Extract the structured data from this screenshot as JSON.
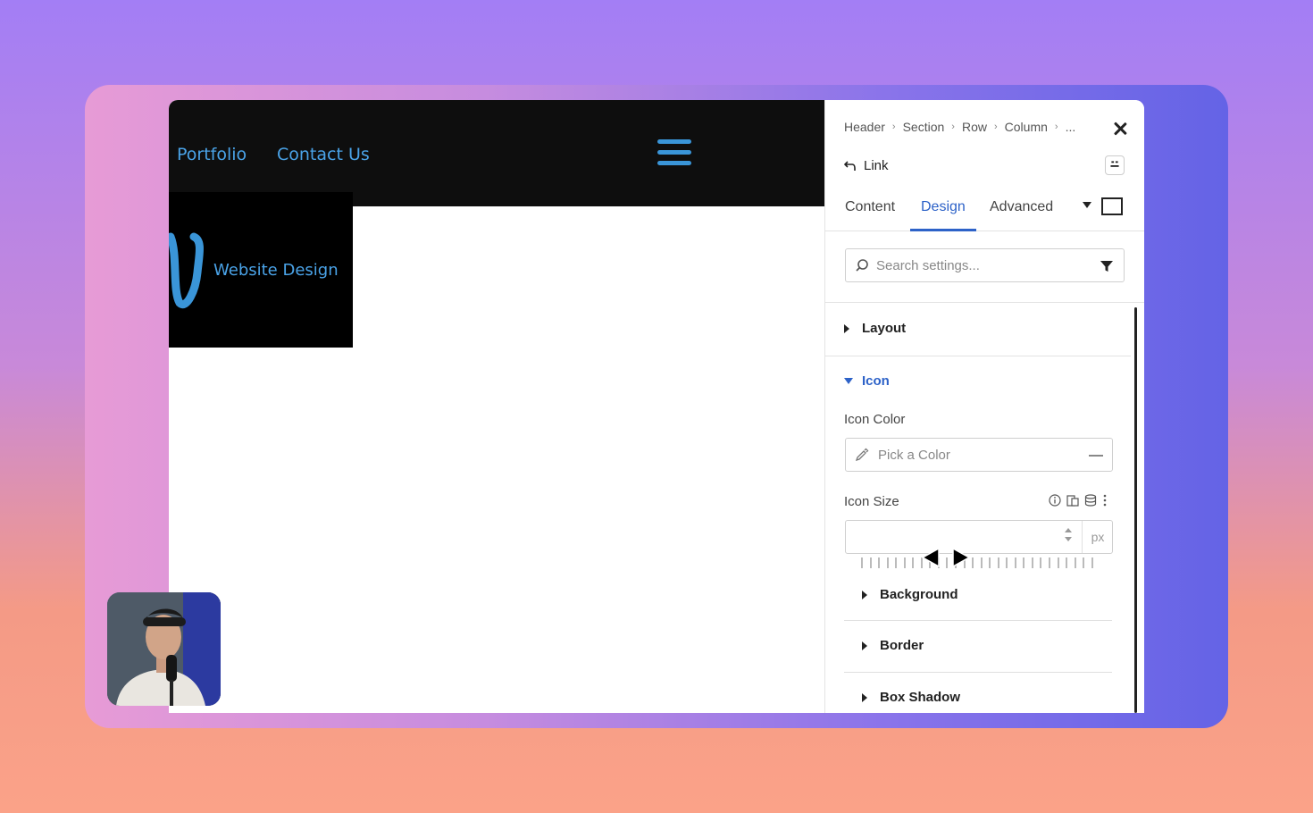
{
  "site": {
    "nav": [
      "Portfolio",
      "Contact Us"
    ],
    "logo_text": "Website Design"
  },
  "panel": {
    "breadcrumb": [
      "Header",
      "Section",
      "Row",
      "Column",
      "..."
    ],
    "element_name": "Link",
    "tabs": [
      {
        "label": "Content",
        "active": false
      },
      {
        "label": "Design",
        "active": true
      },
      {
        "label": "Advanced",
        "active": false
      }
    ],
    "search": {
      "placeholder": "Search settings..."
    },
    "sections": {
      "layout": "Layout",
      "icon": "Icon",
      "icon_color_label": "Icon Color",
      "icon_color_placeholder": "Pick a Color",
      "icon_size_label": "Icon Size",
      "icon_size_unit": "px",
      "background": "Background",
      "border": "Border",
      "box_shadow": "Box Shadow"
    }
  },
  "colors": {
    "accent": "#2d62c8",
    "site_link": "#4aa3e8",
    "header_bg": "#0e0e0e"
  }
}
